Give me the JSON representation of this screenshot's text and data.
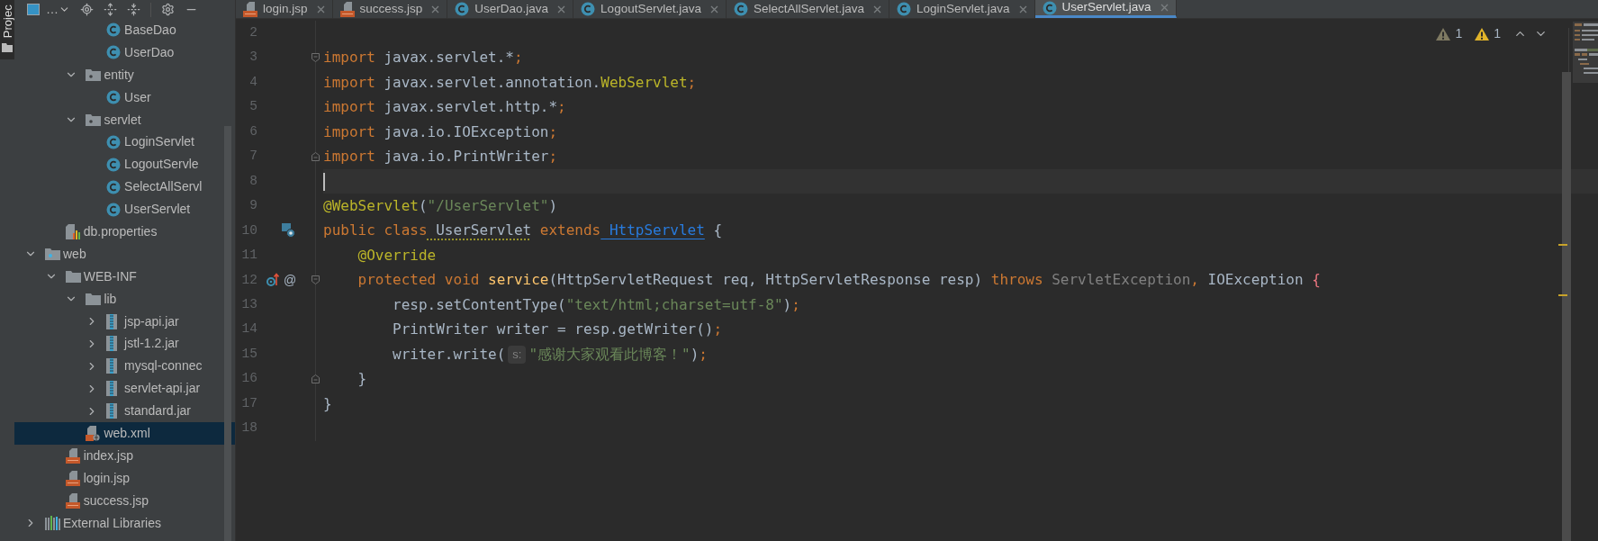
{
  "side_strip": {
    "label": "Projec"
  },
  "project_toolbar": {
    "view_label": "…"
  },
  "tree": [
    {
      "children": [
        {
          "children": [
            {
              "children": [
                {
                  "label": "BaseDao",
                  "kind": "class",
                  "selected": false
                },
                {
                  "label": "UserDao",
                  "kind": "class",
                  "selected": false
                }
              ]
            },
            {
              "label": "entity",
              "kind": "package",
              "expanded": true,
              "selected": false,
              "children": [
                {
                  "label": "User",
                  "kind": "class",
                  "selected": false
                }
              ]
            },
            {
              "label": "servlet",
              "kind": "package",
              "expanded": true,
              "selected": false,
              "children": [
                {
                  "label": "LoginServlet",
                  "kind": "class",
                  "selected": false
                },
                {
                  "label": "LogoutServle",
                  "kind": "class",
                  "selected": false
                },
                {
                  "label": "SelectAllServl",
                  "kind": "class",
                  "selected": false
                },
                {
                  "label": "UserServlet",
                  "kind": "class",
                  "selected": false
                }
              ]
            }
          ]
        },
        {
          "label": "db.properties",
          "kind": "properties",
          "selected": false
        }
      ]
    },
    {
      "label": "web",
      "kind": "web-folder",
      "expanded": true,
      "selected": false,
      "children": [
        {
          "label": "WEB-INF",
          "kind": "folder",
          "expanded": true,
          "selected": false,
          "children": [
            {
              "label": "lib",
              "kind": "folder",
              "expanded": true,
              "selected": false,
              "children": [
                {
                  "label": "jsp-api.jar",
                  "kind": "jar",
                  "expanded": false,
                  "selected": false
                },
                {
                  "label": "jstl-1.2.jar",
                  "kind": "jar",
                  "expanded": false,
                  "selected": false
                },
                {
                  "label": "mysql-connec",
                  "kind": "jar",
                  "expanded": false,
                  "selected": false
                },
                {
                  "label": "servlet-api.jar",
                  "kind": "jar",
                  "expanded": false,
                  "selected": false
                },
                {
                  "label": "standard.jar",
                  "kind": "jar",
                  "expanded": false,
                  "selected": false
                }
              ]
            },
            {
              "label": "web.xml",
              "kind": "xml",
              "selected": true
            }
          ]
        },
        {
          "label": "index.jsp",
          "kind": "jsp",
          "selected": false
        },
        {
          "label": "login.jsp",
          "kind": "jsp",
          "selected": false
        },
        {
          "label": "success.jsp",
          "kind": "jsp",
          "selected": false
        }
      ]
    },
    {
      "label": "External Libraries",
      "kind": "libraries",
      "expanded": false,
      "selected": false
    }
  ],
  "tabs": [
    {
      "label": "login.jsp",
      "kind": "jsp",
      "selected": false
    },
    {
      "label": "success.jsp",
      "kind": "jsp",
      "selected": false
    },
    {
      "label": "UserDao.java",
      "kind": "class",
      "selected": false
    },
    {
      "label": "LogoutServlet.java",
      "kind": "class",
      "selected": false
    },
    {
      "label": "SelectAllServlet.java",
      "kind": "class",
      "selected": false
    },
    {
      "label": "LoginServlet.java",
      "kind": "class",
      "selected": false
    },
    {
      "label": "UserServlet.java",
      "kind": "class",
      "selected": true
    }
  ],
  "inspections": [
    {
      "kind": "weak",
      "count": "1"
    },
    {
      "kind": "warning",
      "count": "1"
    }
  ],
  "lines": [
    {
      "number": "2",
      "current": false
    },
    {
      "number": "3",
      "current": false,
      "fold_start": true,
      "tokens": [
        {
          "text": "import",
          "kind": "keyword"
        },
        {
          "text": " javax.servlet.*",
          "kind": "plain"
        },
        {
          "text": ";",
          "kind": "punct"
        }
      ]
    },
    {
      "number": "4",
      "current": false,
      "tokens": [
        {
          "text": "import",
          "kind": "keyword"
        },
        {
          "text": " javax.servlet.annotation.",
          "kind": "plain"
        },
        {
          "text": "WebServlet",
          "kind": "annotation"
        },
        {
          "text": ";",
          "kind": "punct"
        }
      ]
    },
    {
      "number": "5",
      "current": false,
      "tokens": [
        {
          "text": "import",
          "kind": "keyword"
        },
        {
          "text": " javax.servlet.http.*",
          "kind": "plain"
        },
        {
          "text": ";",
          "kind": "punct"
        }
      ]
    },
    {
      "number": "6",
      "current": false,
      "tokens": [
        {
          "text": "import",
          "kind": "keyword"
        },
        {
          "text": " java.io.IOException",
          "kind": "plain"
        },
        {
          "text": ";",
          "kind": "punct"
        }
      ]
    },
    {
      "number": "7",
      "current": false,
      "fold_end": true,
      "tokens": [
        {
          "text": "import",
          "kind": "keyword"
        },
        {
          "text": " java.io.PrintWriter",
          "kind": "plain"
        },
        {
          "text": ";",
          "kind": "punct"
        }
      ]
    },
    {
      "number": "8",
      "current": true
    },
    {
      "number": "9",
      "current": false,
      "tokens": [
        {
          "text": "@WebServlet",
          "kind": "annotation"
        },
        {
          "text": "(",
          "kind": "plain"
        },
        {
          "text": "\"/UserServlet\"",
          "kind": "string"
        },
        {
          "text": ")",
          "kind": "plain"
        }
      ]
    },
    {
      "number": "10",
      "current": false,
      "implemented_marker": true,
      "tokens": [
        {
          "text": "public",
          "kind": "keyword"
        },
        {
          "text": " class",
          "kind": "keyword"
        },
        {
          "text": " UserServlet",
          "kind": "underlined"
        },
        {
          "text": " extends",
          "kind": "keyword"
        },
        {
          "text": " HttpServlet",
          "kind": "link"
        },
        {
          "text": " {",
          "kind": "plain"
        }
      ]
    },
    {
      "number": "11",
      "current": false,
      "tokens": [
        {
          "text": "    @Override",
          "kind": "annotation"
        }
      ]
    },
    {
      "number": "12",
      "current": false,
      "fold_start": true,
      "override_marker": true,
      "gutter_glyph": "@",
      "tokens": [
        {
          "text": "    protected",
          "kind": "keyword"
        },
        {
          "text": " void",
          "kind": "keyword"
        },
        {
          "text": " service",
          "kind": "method"
        },
        {
          "text": "(HttpServletRequest req, HttpServletResponse resp) ",
          "kind": "plain"
        },
        {
          "text": "throws",
          "kind": "keyword"
        },
        {
          "text": " ServletException",
          "kind": "unused"
        },
        {
          "text": ",",
          "kind": "punct"
        },
        {
          "text": " IOException ",
          "kind": "plain"
        },
        {
          "text": "{",
          "kind": "brace"
        }
      ]
    },
    {
      "number": "13",
      "current": false,
      "tokens": [
        {
          "text": "        resp.setContentType(",
          "kind": "plain"
        },
        {
          "text": "\"text/html;charset=utf-8\"",
          "kind": "string"
        },
        {
          "text": ")",
          "kind": "plain"
        },
        {
          "text": ";",
          "kind": "punct"
        }
      ]
    },
    {
      "number": "14",
      "current": false,
      "tokens": [
        {
          "text": "        PrintWriter writer = resp.getWriter()",
          "kind": "plain"
        },
        {
          "text": ";",
          "kind": "punct"
        }
      ]
    },
    {
      "number": "15",
      "current": false,
      "tokens": [
        {
          "text": "        writer.write(",
          "kind": "plain"
        },
        {
          "text": "s:",
          "kind": "hint"
        },
        {
          "text": "\"感谢大家观看此博客！\"",
          "kind": "string"
        },
        {
          "text": ")",
          "kind": "plain"
        },
        {
          "text": ";",
          "kind": "punct"
        }
      ]
    },
    {
      "number": "16",
      "current": false,
      "fold_end": true,
      "tokens": [
        {
          "text": "    }",
          "kind": "plain"
        }
      ]
    },
    {
      "number": "17",
      "current": false,
      "tokens": [
        {
          "text": "}",
          "kind": "plain"
        }
      ]
    },
    {
      "number": "18",
      "current": false
    }
  ]
}
